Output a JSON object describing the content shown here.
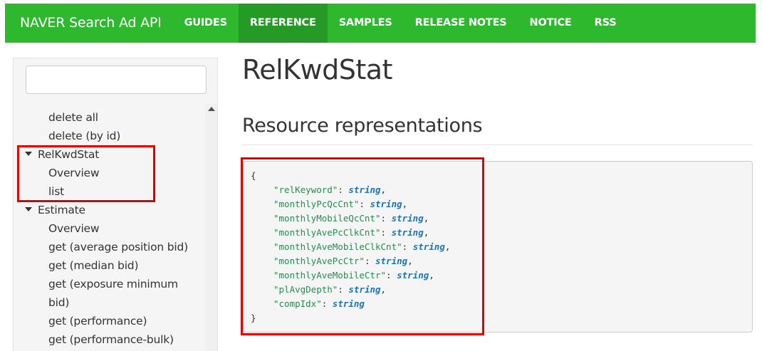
{
  "navbar": {
    "brand": "NAVER Search Ad API",
    "items": [
      {
        "label": "GUIDES",
        "active": false
      },
      {
        "label": "REFERENCE",
        "active": true
      },
      {
        "label": "SAMPLES",
        "active": false
      },
      {
        "label": "RELEASE NOTES",
        "active": false
      },
      {
        "label": "NOTICE",
        "active": false
      },
      {
        "label": "RSS",
        "active": false
      }
    ]
  },
  "sidebar": {
    "search": {
      "value": "",
      "placeholder": ""
    },
    "items": [
      {
        "label": "delete all",
        "kind": "leaf"
      },
      {
        "label": "delete (by id)",
        "kind": "leaf"
      },
      {
        "label": "RelKwdStat",
        "kind": "group",
        "expanded": true
      },
      {
        "label": "Overview",
        "kind": "leaf"
      },
      {
        "label": "list",
        "kind": "leaf"
      },
      {
        "label": "Estimate",
        "kind": "group",
        "expanded": true
      },
      {
        "label": "Overview",
        "kind": "leaf"
      },
      {
        "label": "get (average position bid)",
        "kind": "leaf"
      },
      {
        "label": "get (median bid)",
        "kind": "leaf"
      },
      {
        "label": "get (exposure minimum",
        "kind": "leaf"
      },
      {
        "label": "bid)",
        "kind": "leaf"
      },
      {
        "label": "get (performance)",
        "kind": "leaf"
      },
      {
        "label": "get (performance-bulk)",
        "kind": "leaf"
      }
    ]
  },
  "main": {
    "title": "RelKwdStat",
    "section_title": "Resource representations",
    "code": {
      "open": "{",
      "close": "}",
      "fields": [
        {
          "key": "\"relKeyword\"",
          "type": "string",
          "sep": ","
        },
        {
          "key": "\"monthlyPcQcCnt\"",
          "type": "string",
          "sep": ","
        },
        {
          "key": "\"monthlyMobileQcCnt\"",
          "type": "string",
          "sep": ","
        },
        {
          "key": "\"monthlyAvePcClkCnt\"",
          "type": "string",
          "sep": ","
        },
        {
          "key": "\"monthlyAveMobileClkCnt\"",
          "type": "string",
          "sep": ","
        },
        {
          "key": "\"monthlyAvePcCtr\"",
          "type": "string",
          "sep": ","
        },
        {
          "key": "\"monthlyAveMobileCtr\"",
          "type": "string",
          "sep": ","
        },
        {
          "key": "\"plAvgDepth\"",
          "type": "string",
          "sep": ","
        },
        {
          "key": "\"compIdx\"",
          "type": "string",
          "sep": ""
        }
      ]
    }
  },
  "colors": {
    "navbar": "#2eb82e",
    "navbar_active": "#269a26",
    "highlight": "#e00000",
    "code_key": "#2a8a50",
    "code_type": "#1e73b0"
  }
}
